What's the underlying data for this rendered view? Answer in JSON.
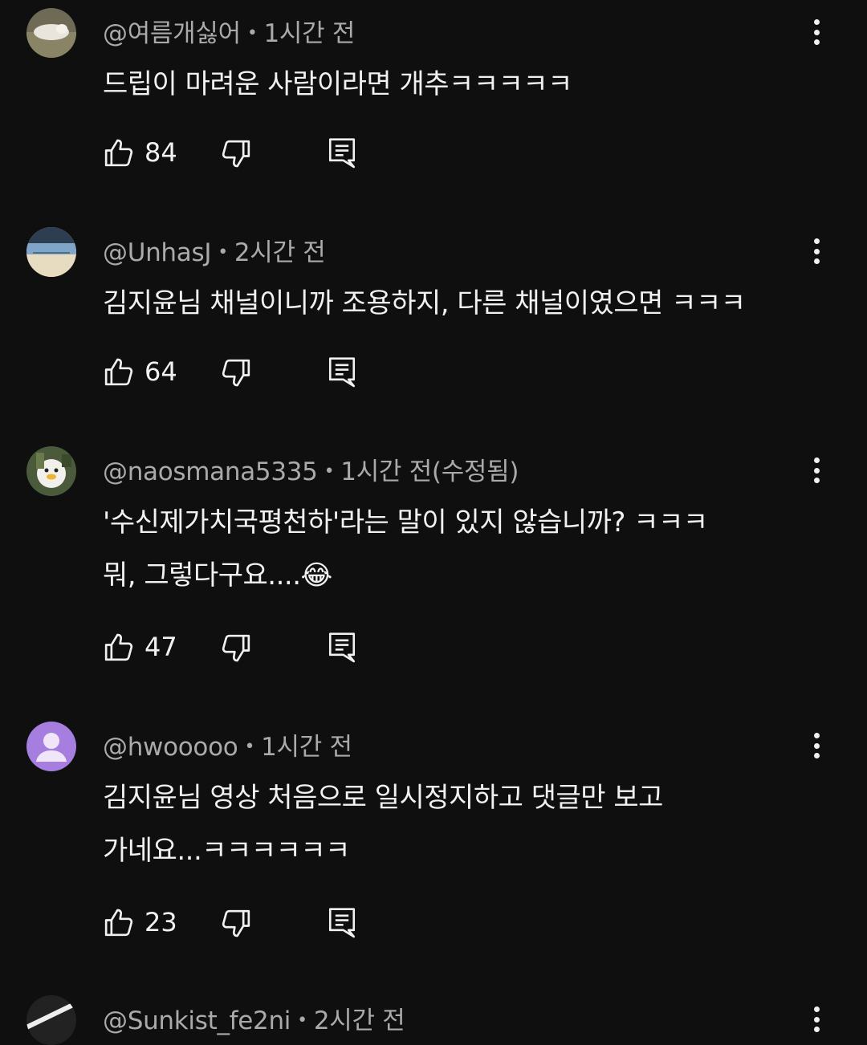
{
  "comments": [
    {
      "author": "@여름개싫어",
      "time": "1시간 전",
      "lines": [
        "드립이 마려운 사람이라면 개추ㅋㅋㅋㅋㅋ"
      ],
      "likes": "84"
    },
    {
      "author": "@UnhasJ",
      "time": "2시간 전",
      "lines": [
        "김지윤님 채널이니까 조용하지, 다른 채널이였으면 ㅋㅋㅋ"
      ],
      "likes": "64"
    },
    {
      "author": "@naosmana5335",
      "time": "1시간 전(수정됨)",
      "lines": [
        "'수신제가치국평천하'라는 말이 있지 않습니까? ㅋㅋㅋ",
        "뭐, 그렇다구요....😂"
      ],
      "likes": "47"
    },
    {
      "author": "@hwooooo",
      "time": "1시간 전",
      "lines": [
        "김지윤님 영상 처음으로 일시정지하고 댓글만 보고",
        "가네요...ㅋㅋㅋㅋㅋㅋ"
      ],
      "likes": "23"
    }
  ],
  "partial_comment": {
    "author": "@Sunkist_fe2ni",
    "time": "2시간 전"
  },
  "colors": {
    "background": "#0f0f0f",
    "text": "#f1f1f1",
    "meta": "#aaaaaa",
    "default_avatar": "#a67ee0"
  },
  "icons": {
    "like": "thumb-up-icon",
    "dislike": "thumb-down-icon",
    "reply": "reply-comment-icon",
    "more": "more-vertical-icon"
  }
}
